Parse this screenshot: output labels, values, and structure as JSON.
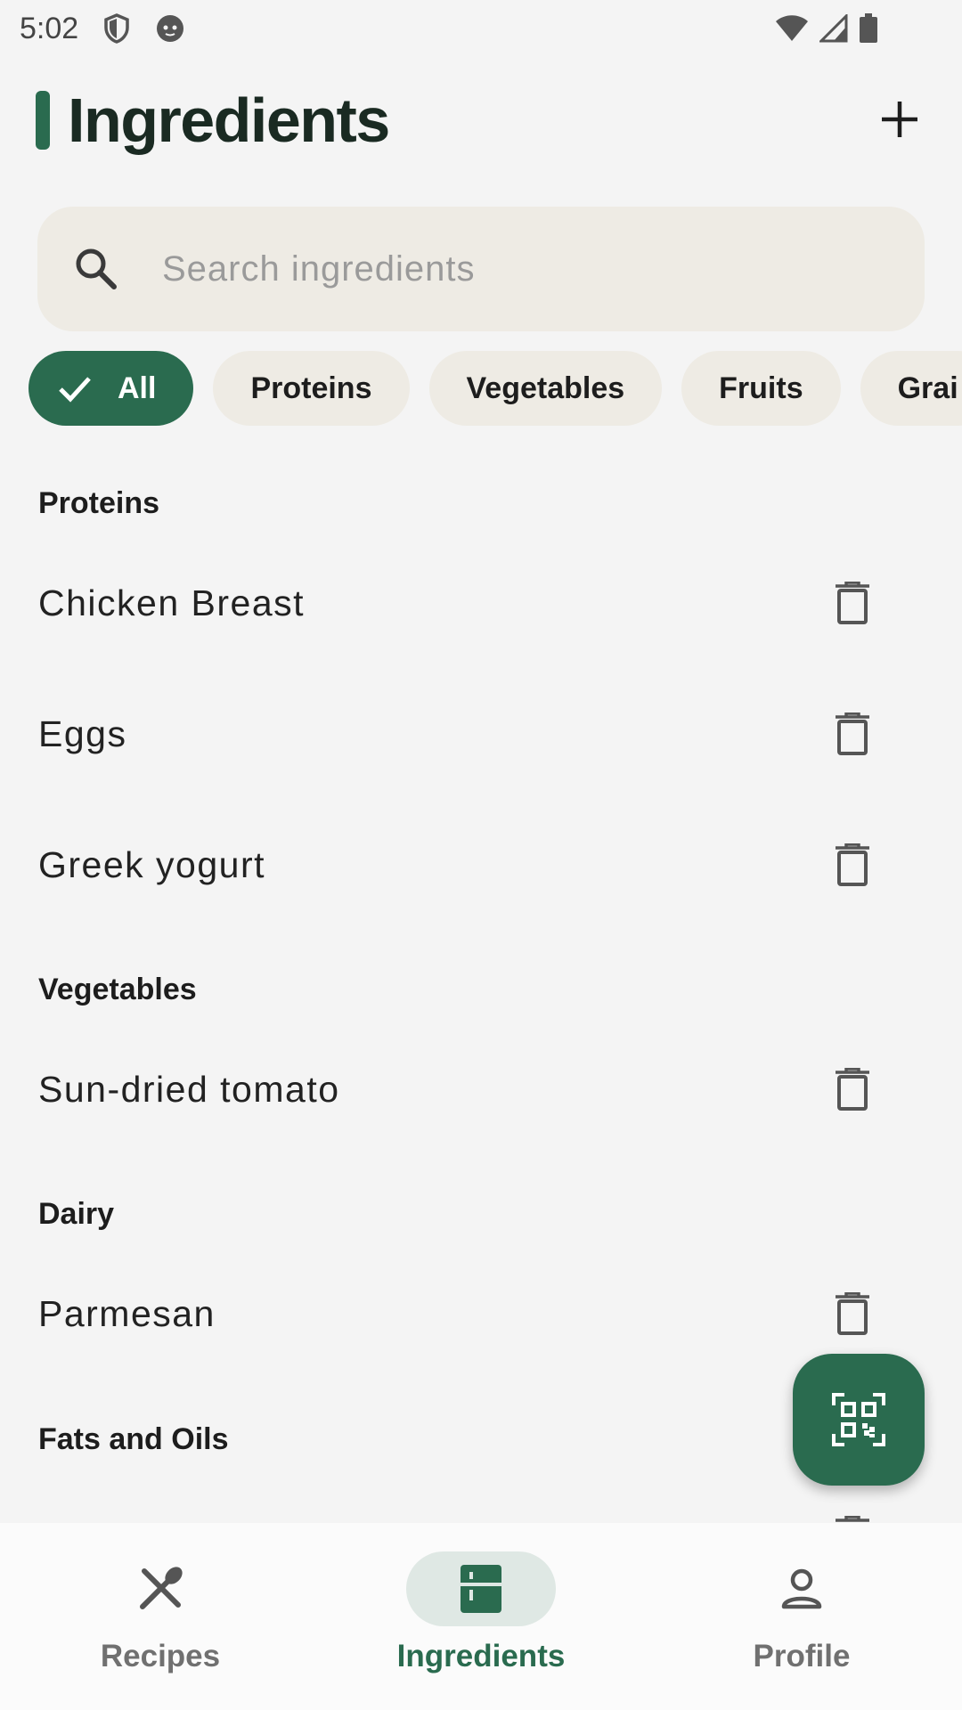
{
  "status_bar": {
    "time": "5:02"
  },
  "header": {
    "title": "Ingredients"
  },
  "search": {
    "placeholder": "Search ingredients"
  },
  "filters": [
    {
      "label": "All",
      "selected": true
    },
    {
      "label": "Proteins",
      "selected": false
    },
    {
      "label": "Vegetables",
      "selected": false
    },
    {
      "label": "Fruits",
      "selected": false
    },
    {
      "label": "Grai",
      "selected": false
    }
  ],
  "sections": [
    {
      "title": "Proteins",
      "items": [
        "Chicken Breast",
        "Eggs",
        "Greek yogurt"
      ]
    },
    {
      "title": "Vegetables",
      "items": [
        "Sun-dried tomato"
      ]
    },
    {
      "title": "Dairy",
      "items": [
        "Parmesan"
      ]
    },
    {
      "title": "Fats and Oils",
      "items": []
    }
  ],
  "bottom_nav": [
    {
      "label": "Recipes",
      "icon": "fork-knife-icon",
      "active": false
    },
    {
      "label": "Ingredients",
      "icon": "fridge-icon",
      "active": true
    },
    {
      "label": "Profile",
      "icon": "person-icon",
      "active": false
    }
  ],
  "colors": {
    "accent": "#2a6b4f",
    "chip_bg": "#eeebe4",
    "background": "#f4f4f4"
  }
}
